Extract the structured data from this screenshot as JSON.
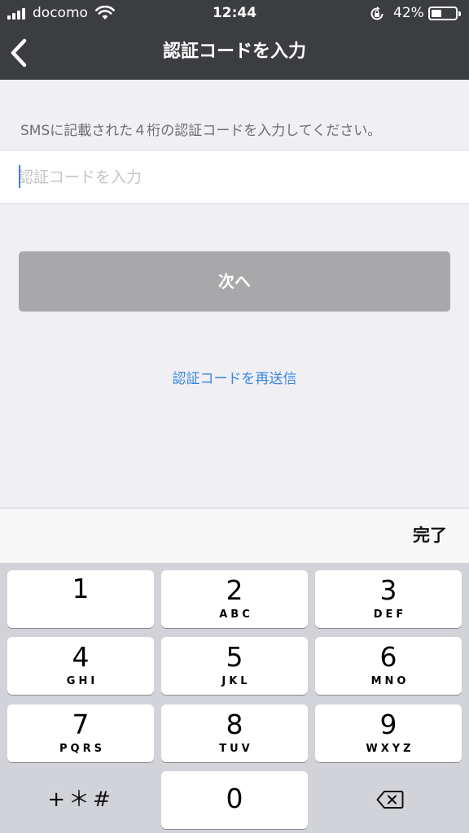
{
  "status": {
    "carrier": "docomo",
    "time": "12:44",
    "battery": "42%",
    "battery_level": 0.42
  },
  "nav": {
    "title": "認証コードを入力",
    "back_icon": "chevron-left-icon"
  },
  "content": {
    "instruction": "SMSに記載された４桁の認証コードを入力してください。",
    "input_placeholder": "認証コードを入力",
    "input_value": "",
    "next_button": "次へ",
    "resend_link": "認証コードを再送信"
  },
  "keyboard": {
    "done": "完了",
    "keys": [
      {
        "num": "1",
        "letters": ""
      },
      {
        "num": "2",
        "letters": "ABC"
      },
      {
        "num": "3",
        "letters": "DEF"
      },
      {
        "num": "4",
        "letters": "GHI"
      },
      {
        "num": "5",
        "letters": "JKL"
      },
      {
        "num": "6",
        "letters": "MNO"
      },
      {
        "num": "7",
        "letters": "PQRS"
      },
      {
        "num": "8",
        "letters": "TUV"
      },
      {
        "num": "9",
        "letters": "WXYZ"
      },
      {
        "num": "0",
        "letters": ""
      }
    ],
    "symbols": "+＊#",
    "delete_icon": "backspace-icon"
  },
  "colors": {
    "nav_background": "#3b3d40",
    "page_background": "#efeff4",
    "button_disabled": "#a8a8ab",
    "link": "#3b86e0",
    "keyboard_background": "#d1d3d9"
  }
}
